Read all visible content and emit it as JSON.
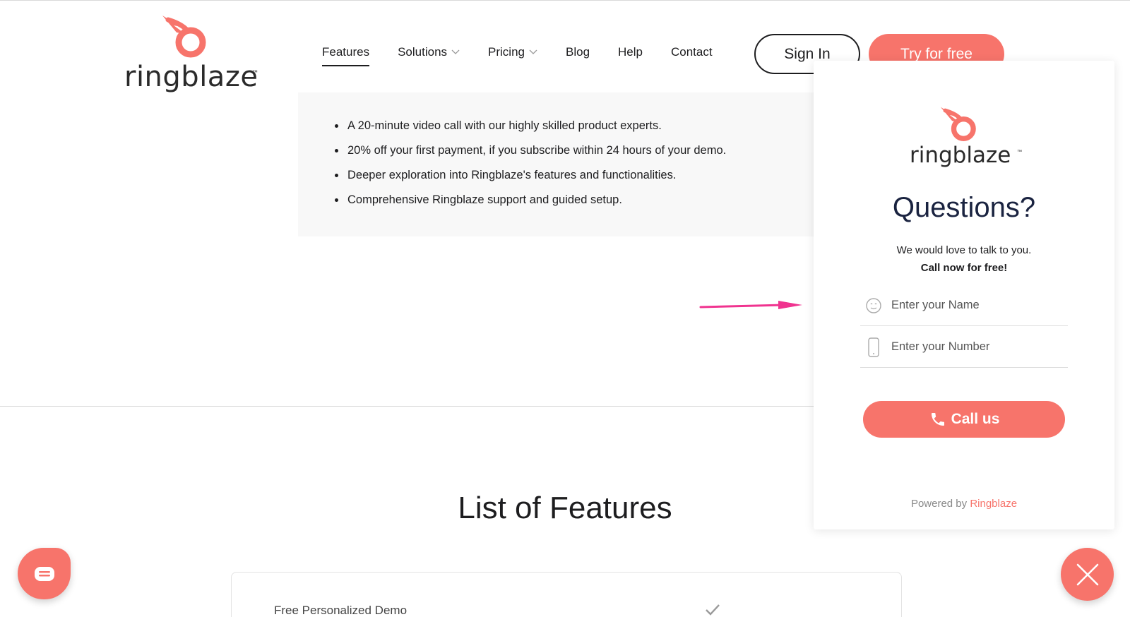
{
  "brand": {
    "name": "ringblaze",
    "tm": "™",
    "accent_color": "#f7746b"
  },
  "nav": {
    "items": [
      {
        "label": "Features",
        "active": true,
        "dropdown": false
      },
      {
        "label": "Solutions",
        "active": false,
        "dropdown": true
      },
      {
        "label": "Pricing",
        "active": false,
        "dropdown": true
      },
      {
        "label": "Blog",
        "active": false,
        "dropdown": false
      },
      {
        "label": "Help",
        "active": false,
        "dropdown": false
      },
      {
        "label": "Contact",
        "active": false,
        "dropdown": false
      }
    ],
    "sign_in": "Sign In",
    "try_free": "Try for free"
  },
  "benefits": [
    "A 20-minute video call with our highly skilled product experts.",
    "20% off your first payment, if you subscribe within 24 hours of your demo.",
    "Deeper exploration into Ringblaze's features and functionalities.",
    "Comprehensive Ringblaze support and guided setup."
  ],
  "features": {
    "title": "List of Features",
    "rows": [
      {
        "label": "Free Personalized Demo",
        "included": true
      }
    ]
  },
  "widget": {
    "title": "Questions?",
    "subtitle": "We would love to talk to you.",
    "subtitle_bold": "Call now for free!",
    "name_placeholder": "Enter your Name",
    "number_placeholder": "Enter your Number",
    "call_label": "Call us",
    "powered_prefix": "Powered by ",
    "powered_brand": "Ringblaze"
  },
  "icons": {
    "chat": "chat-bubble-icon",
    "close": "close-icon",
    "phone": "phone-icon",
    "face": "face-icon",
    "mobile": "mobile-phone-icon",
    "arrow": "pink-arrow-icon"
  }
}
